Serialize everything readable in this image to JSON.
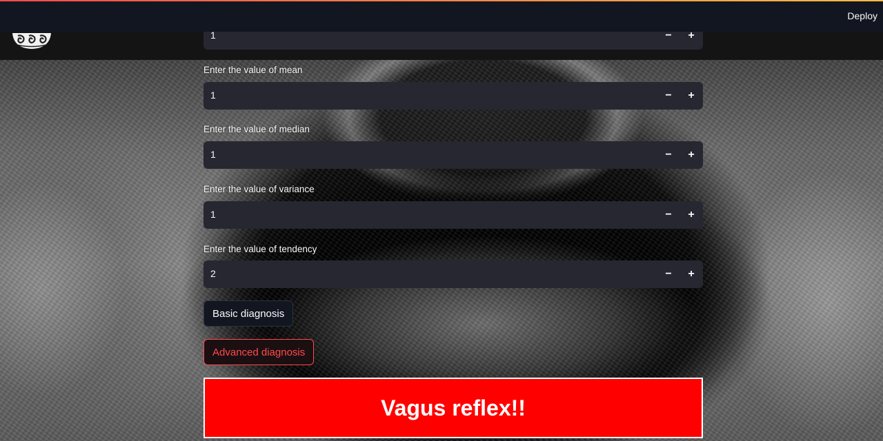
{
  "header": {
    "deploy_label": "Deploy"
  },
  "logo": {
    "icon": "app-logo-icon"
  },
  "form": {
    "fields": [
      {
        "label": "",
        "value": "1"
      },
      {
        "label": "Enter the value of mean",
        "value": "1"
      },
      {
        "label": "Enter the value of median",
        "value": "1"
      },
      {
        "label": "Enter the value of variance",
        "value": "1"
      },
      {
        "label": "Enter the value of tendency",
        "value": "2"
      }
    ],
    "minus_glyph": "−",
    "plus_glyph": "+"
  },
  "buttons": {
    "basic_label": "Basic diagnosis",
    "advanced_label": "Advanced diagnosis"
  },
  "result": {
    "text": "Vagus reflex!!"
  },
  "colors": {
    "accent": "#ff4b4b",
    "alert_bg": "#ff0000",
    "input_bg": "#262730",
    "topbar_bg": "#121620"
  }
}
